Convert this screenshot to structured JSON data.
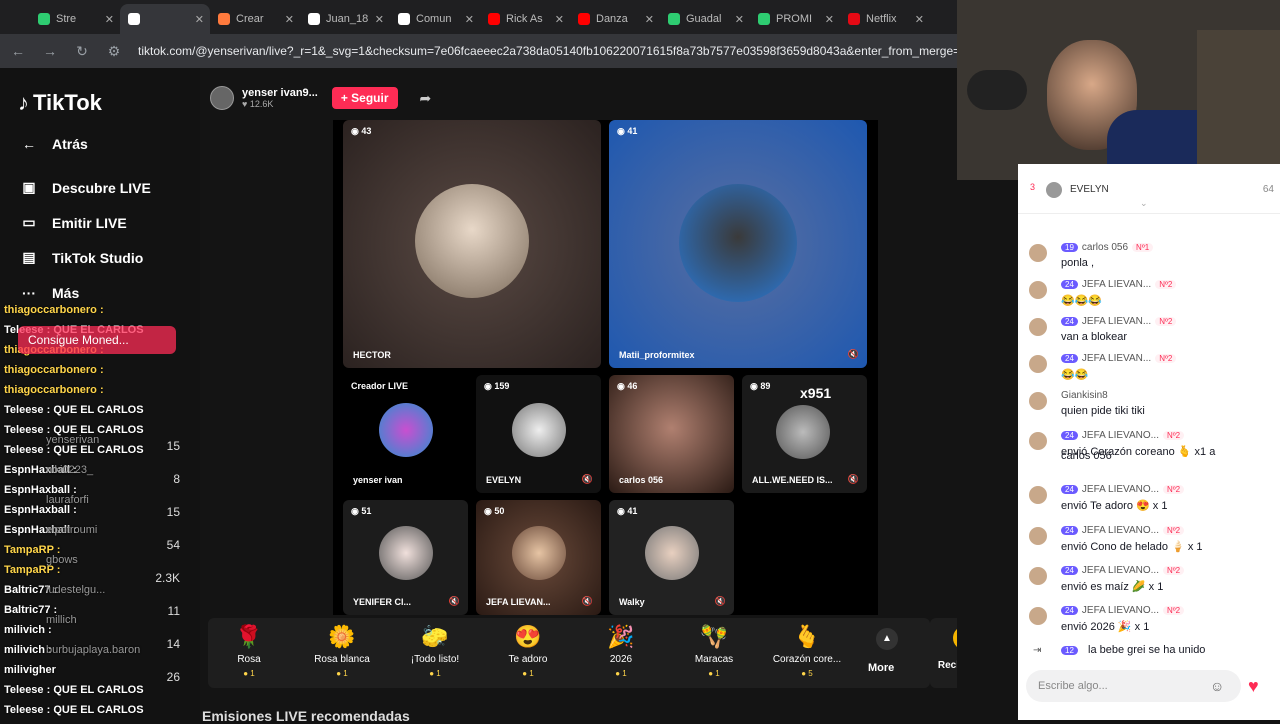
{
  "tabs": [
    {
      "label": "Stre",
      "color": "#2ecc71"
    },
    {
      "label": "",
      "color": "#ffffff"
    },
    {
      "label": "Crear",
      "color": "#ff7a3d"
    },
    {
      "label": "Juan_18",
      "color": "#ffffff"
    },
    {
      "label": "Comun",
      "color": "#ffffff"
    },
    {
      "label": "Rick As",
      "color": "#ff0000"
    },
    {
      "label": "Danza",
      "color": "#ff0000"
    },
    {
      "label": "Guadal",
      "color": "#2ecc71"
    },
    {
      "label": "PROMI",
      "color": "#2ecc71"
    },
    {
      "label": "Netflix",
      "color": "#e50914"
    }
  ],
  "url": "tiktok.com/@yenserivan/live?_r=1&_svg=1&checksum=7e06fcaeeec2a738da05140fb106220071615f8a73b7577e03598f3659d8043a&enter_from_merge=share&enter_m",
  "sidebar": {
    "logo": "TikTok",
    "items": [
      {
        "label": "Atrás",
        "icon": "←"
      },
      {
        "label": "Descubre LIVE",
        "icon": "▣"
      },
      {
        "label": "Emitir LIVE",
        "icon": "▭"
      },
      {
        "label": "TikTok Studio",
        "icon": "▤"
      },
      {
        "label": "Más",
        "icon": "···"
      }
    ]
  },
  "overlay": {
    "lines": [
      {
        "text": "thiagoccarbonero :",
        "color": "#ffd54a"
      },
      {
        "text": "Teleese : QUE  EL CARLOS",
        "color": "#ffffff"
      },
      {
        "text": "thiagoccarbonero :",
        "color": "#ffd54a"
      },
      {
        "text": "thiagoccarbonero :",
        "color": "#ffd54a"
      },
      {
        "text": "thiagoccarbonero :",
        "color": "#ffd54a"
      },
      {
        "text": "Teleese : QUE  EL CARLOS",
        "color": "#ffffff"
      },
      {
        "text": "Teleese : QUE  EL CARLOS",
        "color": "#ffffff"
      },
      {
        "text": "Teleese : QUE  EL CARLOS",
        "color": "#ffffff"
      },
      {
        "text": "EspnHaxball :",
        "color": "#ffffff"
      },
      {
        "text": "EspnHaxball :",
        "color": "#ffffff"
      },
      {
        "text": "EspnHaxball :",
        "color": "#ffffff"
      },
      {
        "text": "EspnHaxball :",
        "color": "#ffffff"
      },
      {
        "text": "TampaRP :",
        "color": "#ffd54a"
      },
      {
        "text": "TampaRP :",
        "color": "#ffd54a"
      },
      {
        "text": "Baltric77 :",
        "color": "#ffffff"
      },
      {
        "text": "Baltric77 :",
        "color": "#ffffff"
      },
      {
        "text": "milivich :",
        "color": "#ffffff"
      },
      {
        "text": "milivich :",
        "color": "#ffffff"
      },
      {
        "text": "milivigher",
        "color": "#ffffff"
      },
      {
        "text": "Teleese : QUE  EL CARLOS",
        "color": "#ffffff"
      },
      {
        "text": "Teleese : QUE  EL CARLOS",
        "color": "#ffffff"
      }
    ],
    "promo": "Consigue Moned...",
    "under_names": [
      "yenserivan",
      "niki0223_",
      "lauraforfi",
      "elpotroumi",
      "gbows",
      "ludestelgu...",
      "millich",
      "burbujaplaya.baron"
    ],
    "numbers": [
      "15",
      "8",
      "15",
      "54",
      "2.3K",
      "11",
      "14",
      "26"
    ]
  },
  "host": {
    "name": "yenser  ivan9...",
    "likes": "12.6K",
    "follow_label": "+ Seguir"
  },
  "cells": [
    {
      "count": "43",
      "name": "HECTOR"
    },
    {
      "count": "41",
      "name": "Matii_proformitex"
    },
    {
      "count": "",
      "name": "yenser  ivan",
      "tag": "Creador LIVE"
    },
    {
      "count": "159",
      "name": "EVELYN"
    },
    {
      "count": "46",
      "name": "carlos 056"
    },
    {
      "count": "89",
      "name": "ALL.WE.NEED IS..."
    },
    {
      "count": "51",
      "name": "YENIFER Cl..."
    },
    {
      "count": "50",
      "name": "JEFA LIEVAN..."
    },
    {
      "count": "41",
      "name": "Walky"
    }
  ],
  "multiplier": "x951",
  "gifts": [
    {
      "name": "Rosa",
      "price": "1",
      "icon": "🌹"
    },
    {
      "name": "Rosa blanca",
      "price": "1",
      "icon": "🌼"
    },
    {
      "name": "¡Todo listo!",
      "price": "1",
      "icon": "🧽"
    },
    {
      "name": "Te adoro",
      "price": "1",
      "icon": "😍"
    },
    {
      "name": "2026",
      "price": "1",
      "icon": "🎉"
    },
    {
      "name": "Maracas",
      "price": "1",
      "icon": "🪇"
    },
    {
      "name": "Corazón core...",
      "price": "5",
      "icon": "🫰"
    }
  ],
  "gifts_more": "More",
  "recharge": "Recharge",
  "recommended_title": "Emisiones LIVE recomendadas",
  "chat": {
    "top_name": "EVELYN",
    "top_count": "64",
    "top_rank": "3",
    "messages": [
      {
        "lvl": "19",
        "user": "carlos 056",
        "rank": "Nº1",
        "text": "ponla ,"
      },
      {
        "lvl": "24",
        "user": "JEFA LIEVAN...",
        "rank": "Nº2",
        "text": "😂😂😂"
      },
      {
        "lvl": "24",
        "user": "JEFA LIEVAN...",
        "rank": "Nº2",
        "text": "van a blokear"
      },
      {
        "lvl": "24",
        "user": "JEFA LIEVAN...",
        "rank": "Nº2",
        "text": "😂😂"
      },
      {
        "lvl": "",
        "user": "Giankisin8",
        "rank": "",
        "text": "quien pide tiki tiki"
      },
      {
        "lvl": "24",
        "user": "JEFA LIEVANO...",
        "rank": "Nº2",
        "text": "envió Corazón coreano 🫰 x1 a"
      },
      {
        "lvl": "",
        "user": "",
        "rank": "",
        "text": "carlos 056"
      },
      {
        "lvl": "24",
        "user": "JEFA LIEVANO...",
        "rank": "Nº2",
        "text": "envió Te adoro 😍 x 1"
      },
      {
        "lvl": "24",
        "user": "JEFA LIEVANO...",
        "rank": "Nº2",
        "text": "envió Cono de helado 🍦 x 1"
      },
      {
        "lvl": "24",
        "user": "JEFA LIEVANO...",
        "rank": "Nº2",
        "text": "envió es maíz 🌽 x 1"
      },
      {
        "lvl": "24",
        "user": "JEFA LIEVANO...",
        "rank": "Nº2",
        "text": "envió 2026 🎉 x 1"
      }
    ],
    "joined_lvl": "12",
    "joined_text": "la bebe grei  se ha unido",
    "input_placeholder": "Escribe algo..."
  }
}
